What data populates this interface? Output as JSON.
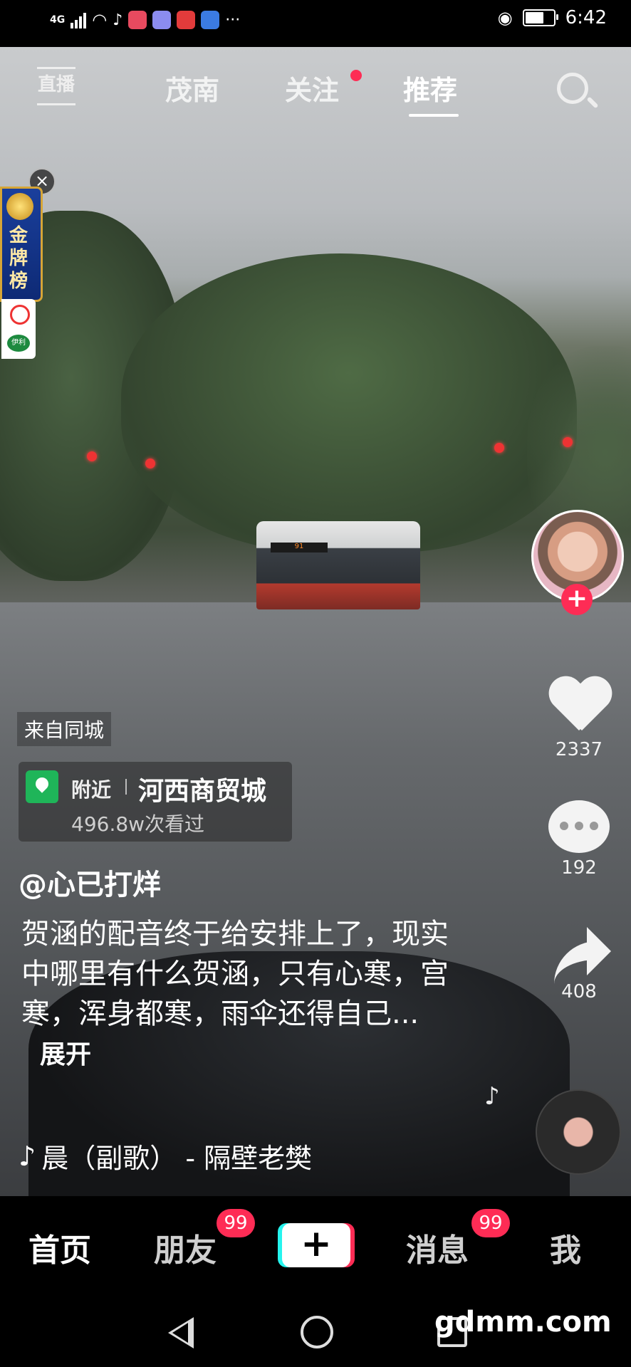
{
  "status_bar": {
    "network": "4G",
    "time": "6:42"
  },
  "top_nav": {
    "live_label": "直播",
    "tabs": [
      "茂南",
      "关注",
      "推荐"
    ],
    "active_tab": "推荐"
  },
  "gold_badge": {
    "label": "金牌榜"
  },
  "video": {
    "bus_sign": "91"
  },
  "actions": {
    "likes": "2337",
    "comments": "192",
    "shares": "408"
  },
  "info": {
    "from_city": "来自同城",
    "location_prefix": "附近",
    "location_name": "河西商贸城",
    "views": "496.8w次看过",
    "author": "@心已打烊",
    "description": "贺涵的配音终于给安排上了，现实中哪里有什么贺涵，只有心寒，宫寒，浑身都寒，雨伞还得自己...",
    "expand_label": "展开",
    "music": "晨（副歌） - 隔壁老樊"
  },
  "bottom_nav": {
    "home": "首页",
    "friends": "朋友",
    "friends_badge": "99",
    "create": "+",
    "messages": "消息",
    "messages_badge": "99",
    "me": "我"
  },
  "watermark": "gdmm.com",
  "colors": {
    "accent": "#fe2c55",
    "location_pin": "#1fb559",
    "background": "#000000"
  },
  "icons": [
    "search-icon",
    "heart-icon",
    "comment-icon",
    "share-icon",
    "music-note-icon",
    "location-pin-icon",
    "close-icon",
    "back-icon",
    "home-icon",
    "recent-apps-icon"
  ]
}
